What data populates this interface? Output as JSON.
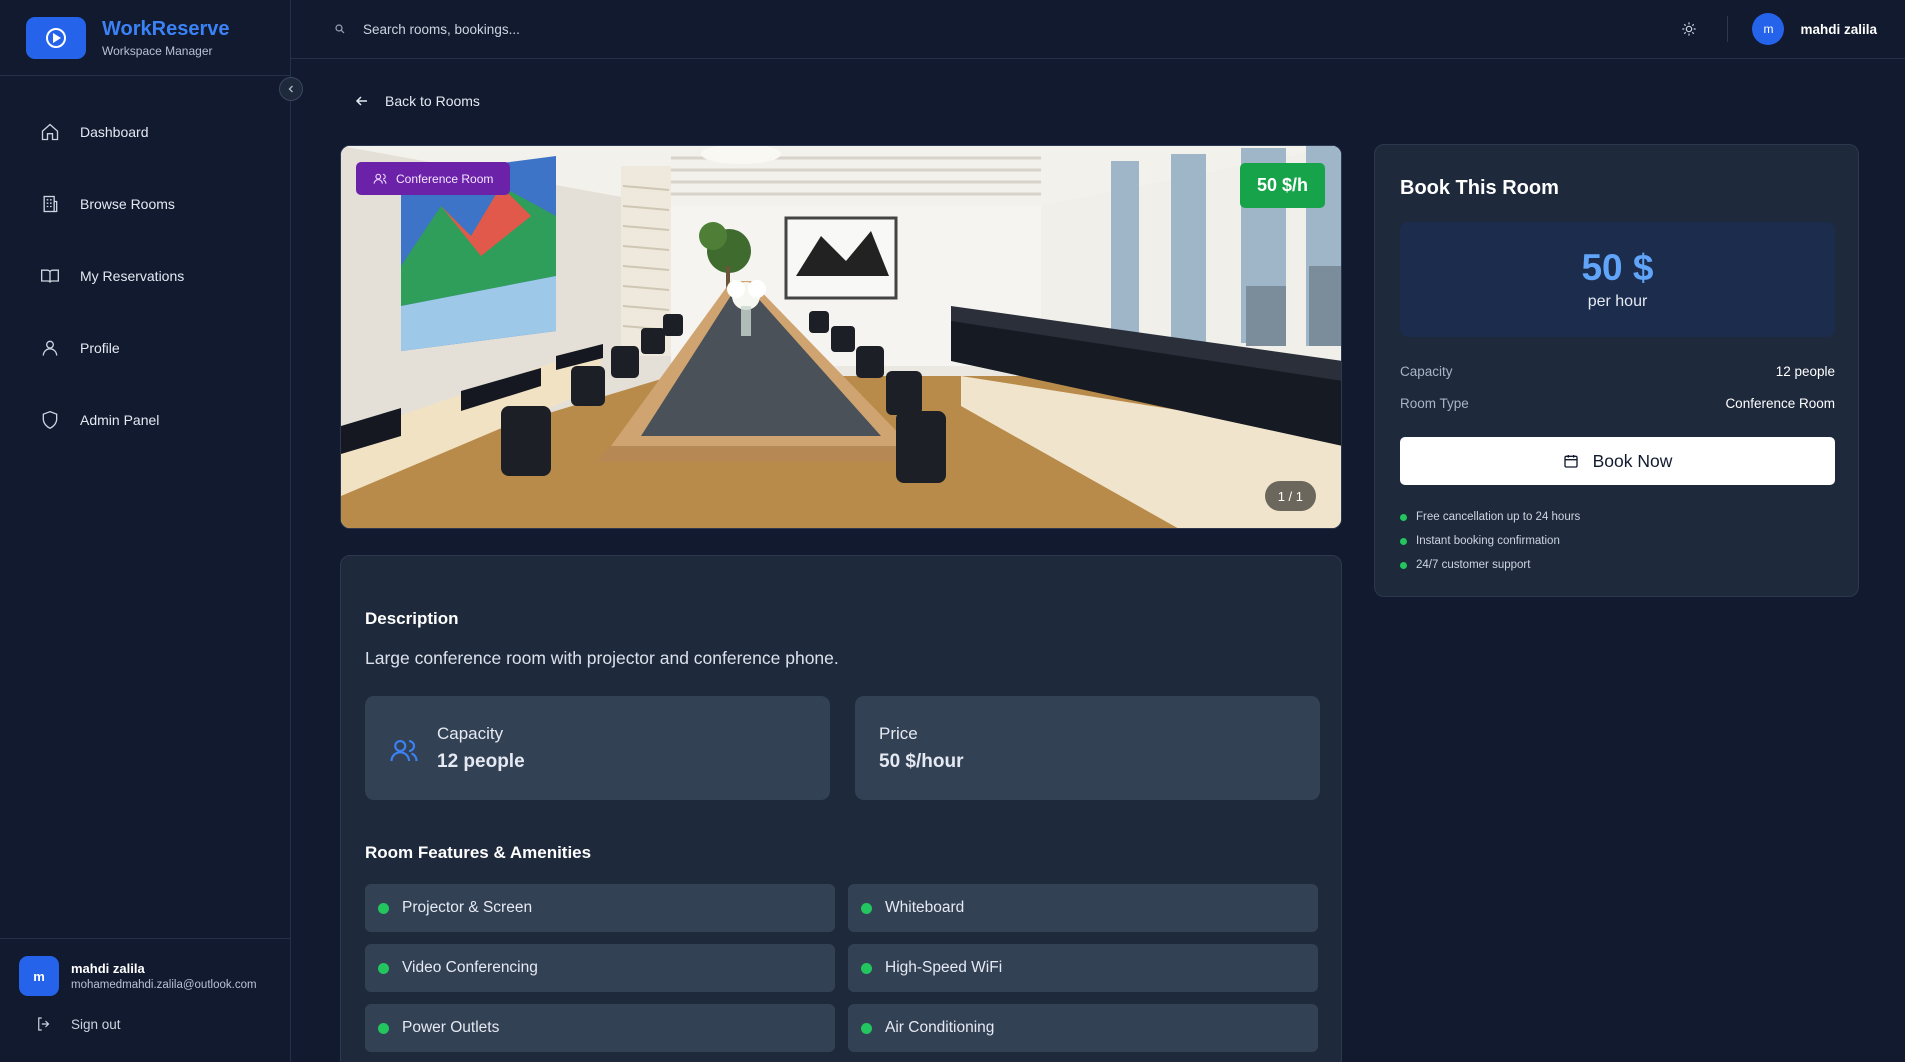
{
  "brand": {
    "name": "WorkReserve",
    "subtitle": "Workspace Manager"
  },
  "sidebar": {
    "items": [
      {
        "label": "Dashboard",
        "icon": "home-icon"
      },
      {
        "label": "Browse Rooms",
        "icon": "building-icon"
      },
      {
        "label": "My Reservations",
        "icon": "book-open-icon"
      },
      {
        "label": "Profile",
        "icon": "user-icon"
      },
      {
        "label": "Admin Panel",
        "icon": "shield-icon"
      }
    ],
    "user": {
      "initial": "m",
      "name": "mahdi zalila",
      "email": "mohamedmahdi.zalila@outlook.com"
    },
    "signout_label": "Sign out"
  },
  "topbar": {
    "search_placeholder": "Search rooms, bookings...",
    "user": {
      "initial": "m",
      "name": "mahdi zalila"
    }
  },
  "back_label": "Back to Rooms",
  "hero": {
    "type_badge": "Conference Room",
    "price_badge": "50 $/h",
    "counter": "1 / 1"
  },
  "details": {
    "description_title": "Description",
    "description": "Large conference room with projector and conference phone.",
    "capacity_label": "Capacity",
    "capacity_value": "12 people",
    "price_label": "Price",
    "price_value": "50 $/hour",
    "features_title": "Room Features & Amenities",
    "features": [
      "Projector & Screen",
      "Whiteboard",
      "Video Conferencing",
      "High-Speed WiFi",
      "Power Outlets",
      "Air Conditioning"
    ]
  },
  "booking": {
    "title": "Book This Room",
    "price": "50 $",
    "per": "per hour",
    "capacity_label": "Capacity",
    "capacity_value": "12 people",
    "room_type_label": "Room Type",
    "room_type_value": "Conference Room",
    "button_label": "Book Now",
    "perks": [
      "Free cancellation up to 24 hours",
      "Instant booking confirmation",
      "24/7 customer support"
    ]
  },
  "colors": {
    "background": "#111a2e",
    "card": "#1e293b",
    "accent": "#2563eb",
    "price_badge": "#16a34a",
    "type_badge": "#6b21a8",
    "success_dot": "#22c55e"
  }
}
